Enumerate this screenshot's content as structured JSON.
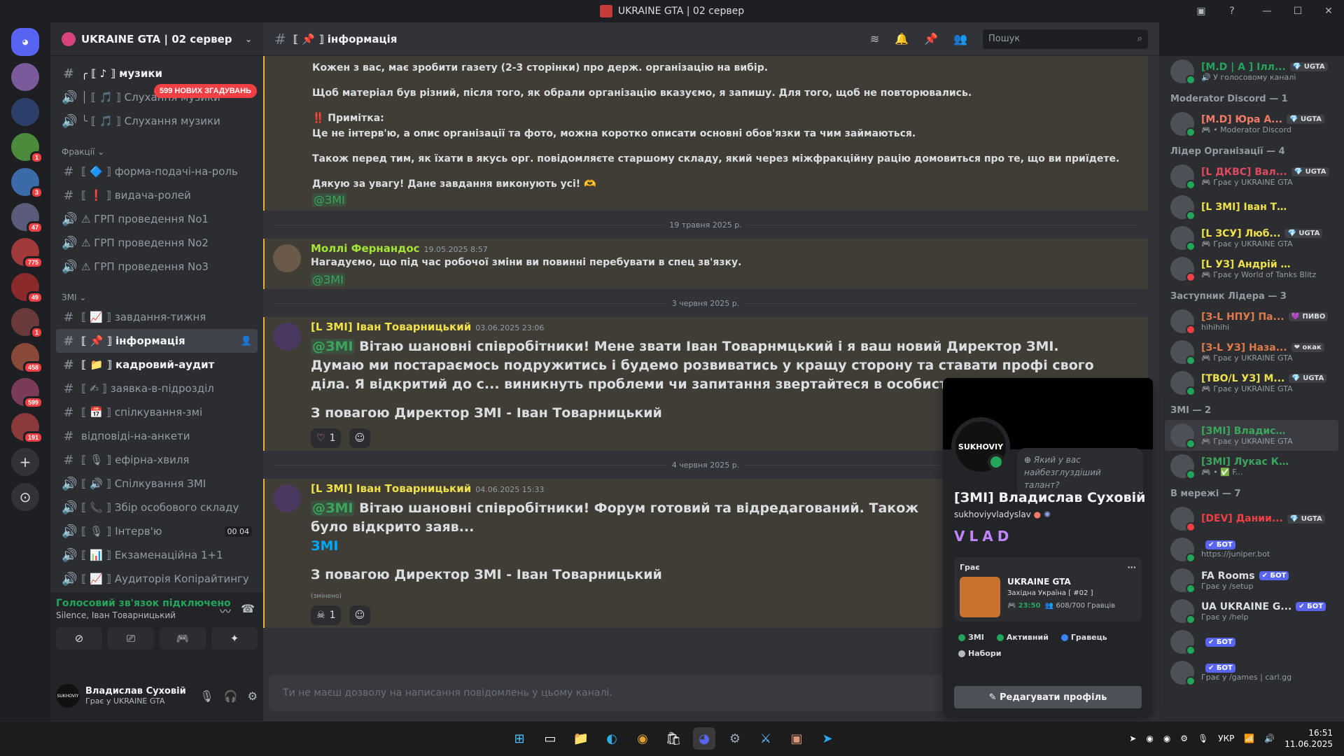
{
  "window": {
    "title": "UKRAINE GTA | 02 сервер"
  },
  "rail": {
    "servers": [
      {
        "name": "discord-home",
        "badge": ""
      },
      {
        "name": "server-1",
        "badge": ""
      },
      {
        "name": "server-2",
        "badge": ""
      },
      {
        "name": "server-3",
        "badge": "1"
      },
      {
        "name": "server-4",
        "badge": "3"
      },
      {
        "name": "server-5",
        "badge": "47"
      },
      {
        "name": "server-6",
        "badge": "775"
      },
      {
        "name": "server-7",
        "badge": "49"
      },
      {
        "name": "server-8",
        "badge": "1"
      },
      {
        "name": "server-9",
        "badge": "458"
      },
      {
        "name": "server-10",
        "badge": "599"
      },
      {
        "name": "server-11",
        "badge": "191"
      }
    ],
    "add": "+",
    "explore": "⊙"
  },
  "sidebar": {
    "guild": "UKRAINE GTA | 02 сервер",
    "mention_pill": "599 НОВИХ ЗГАДУВАНЬ",
    "top_items": [
      {
        "icon": "#",
        "label": "╭ ⟦ ♪ ⟧ музики"
      },
      {
        "icon": "🔊",
        "label": "│ ⟦ 🎵 ⟧ Слухання музики"
      },
      {
        "icon": "🔊",
        "label": "╰ ⟦ 🎵 ⟧ Слухання музики"
      }
    ],
    "cat_fractions": "Фракції ⌄",
    "fraction_items": [
      {
        "icon": "#",
        "label": "⟦ 🔷 ⟧ форма-подачі-на-роль"
      },
      {
        "icon": "#",
        "label": "⟦ ❗ ⟧ видача-ролей"
      },
      {
        "icon": "🔊",
        "label": "⚠ ГРП проведення No1"
      },
      {
        "icon": "🔊",
        "label": "⚠ ГРП проведення No2"
      },
      {
        "icon": "🔊",
        "label": "⚠ ГРП проведення No3"
      }
    ],
    "cat_zmi": "ЗМІ ⌄",
    "zmi_items": [
      {
        "icon": "#",
        "label": "⟦ 📈 ⟧ завдання-тижня"
      },
      {
        "icon": "#",
        "label": "⟦ 📌 ⟧ інформація"
      },
      {
        "icon": "#",
        "label": "⟦ 📁 ⟧ кадровий-аудит"
      },
      {
        "icon": "#",
        "label": "⟦ ✍ ⟧ заявка-в-підрозділ"
      },
      {
        "icon": "#",
        "label": "⟦ 📅 ⟧ спілкування-змі"
      },
      {
        "icon": "#",
        "label": "відповіді-на-анкети"
      },
      {
        "icon": "#",
        "label": "⟦ 🎙 ⟧ ефірна-хвиля"
      },
      {
        "icon": "🔊",
        "label": "⟦ 🔊 ⟧ Спілкування ЗМІ"
      },
      {
        "icon": "🔊",
        "label": "⟦ 📞 ⟧ Збір особового складу"
      },
      {
        "icon": "🔊",
        "label": "⟦ 🎙 ⟧ Інтерв'ю"
      },
      {
        "icon": "🔊",
        "label": "⟦ 📊 ⟧ Екзаменаційна 1+1"
      },
      {
        "icon": "🔊",
        "label": "⟦ 📈 ⟧ Аудиторія Копірайтингу"
      }
    ],
    "interview_limit": "00 04",
    "voice": {
      "status": "Голосовий зв'язок підключено",
      "sub": "Silence, Іван Товарницький"
    },
    "user": {
      "name": "Владислав Суховій",
      "status": "Грає у UKRAINE GTA",
      "avatar_text": "SUKHOVIY"
    }
  },
  "chat": {
    "channel": "⟦ 📌 ⟧ інформація",
    "search_placeholder": "Пошук",
    "composer_placeholder": "Ти не маєш дозволу на написання повідомлень у цьому каналі.",
    "first": {
      "l1": "Кожен з вас, має зробити газету (2-3 сторінки) про держ. організацію на вибір.",
      "l2": "Щоб матеріал був різний, після того, як обрали організацію вказуємо, я запишу. Для того, щоб не повторювались.",
      "note_title": "‼️ Примітка:",
      "l3": "Це не інтерв'ю, а опис організації та фото, можна коротко описати основні обов'язки та чим займаються.",
      "l4": "Також перед тим, як їхати в якусь орг. повідомляєте старшому складу, який через міжфракційну рацію домовиться про те, що ви приїдете.",
      "l5": "Дякую за увагу! Дане завдання виконують усі! 🫶",
      "mention": "@ЗМІ"
    },
    "divider1": "19 травня 2025 р.",
    "molly": {
      "author": "Моллі Фернандос",
      "ts": "19.05.2025 8:57",
      "text": "Нагадуємо, що під час робочої зміни ви повинні перебувати в спец зв'язку.",
      "mention": "@ЗМІ"
    },
    "divider2": "3 червня 2025 р.",
    "ivan1": {
      "author": "[L ЗМІ] Іван Товарницький",
      "ts": "03.06.2025 23:06",
      "mention": "@ЗМІ",
      "text": "Вітаю шановні співробітники! Мене звати Іван Товарнмцький і я ваш новий Директор ЗМІ. Думаю ми постараємось подружитись і будемо розвиватись у кращу сторону та ставати профі свого діла. Я відкритий до с... виникнуть проблеми чи запитання звертайтеся в особисті повідомлення.",
      "sign": "З повагою Директор ЗМІ - Іван Товарницький",
      "react_count": "1"
    },
    "divider3": "4 червня 2025 р.",
    "ivan2": {
      "author": "[L ЗМІ] Іван Товарницький",
      "ts": "04.06.2025 15:33",
      "mention": "@ЗМІ",
      "text": "Вітаю шановні співробітники! Форум готовий та відредагований. Також було відкрито заяв...",
      "text2": "ЗМІ",
      "sign": "З повагою Директор ЗМІ - Іван Товарницький",
      "edited": "(змінено)",
      "react_count": "1"
    }
  },
  "members": {
    "top": {
      "name": "[M.D | A ] Ілл...",
      "tag": "💎 UGTA",
      "status": "🔊 У голосовому каналі",
      "color": "#23a55a"
    },
    "groups": [
      {
        "title": "Moderator Discord — 1",
        "items": [
          {
            "name": "[M.D] Юра А...",
            "tag": "💎 UGTA",
            "status": "🎮 • Moderator Discord",
            "color": "#f47b67",
            "st": "#23a55a"
          }
        ]
      },
      {
        "title": "Лідер Організації — 4",
        "items": [
          {
            "name": "[L ДКВС] Вал...",
            "tag": "💎 UGTA",
            "status": "🎮 Грає у UKRAINE GTA",
            "color": "#e04a5f",
            "st": "#23a55a"
          },
          {
            "name": "[L ЗМІ] Іван Товарни...",
            "tag": "",
            "status": "",
            "color": "#f0e14a",
            "st": "#23a55a"
          },
          {
            "name": "[L ЗСУ] Люб...",
            "tag": "💎 UGTA",
            "status": "🎮 Грає у UKRAINE GTA",
            "color": "#f0e14a",
            "st": "#23a55a"
          },
          {
            "name": "[L УЗ] Андрій Ашваг...",
            "tag": "",
            "status": "🎮 Грає у World of Tanks Blitz",
            "color": "#f0e14a",
            "st": "#f23f43"
          }
        ]
      },
      {
        "title": "Заступник Лідера — 3",
        "items": [
          {
            "name": "[З-L НПУ] Па...",
            "tag": "💜 ПИВО",
            "status": "hihihihi",
            "color": "#e07a4a",
            "st": "#f23f43"
          },
          {
            "name": "[З-L УЗ] Наза...",
            "tag": "❤ окак",
            "status": "🎮 Грає у UKRAINE GTA",
            "color": "#e07a4a",
            "st": "#23a55a"
          },
          {
            "name": "[ТВО/L УЗ] М...",
            "tag": "💎 UGTA",
            "status": "🎮 Грає у UKRAINE GTA",
            "color": "#f0e14a",
            "st": "#23a55a"
          }
        ]
      },
      {
        "title": "ЗМІ — 2",
        "items": [
          {
            "name": "[ЗМІ] Владислав Сух...",
            "tag": "",
            "status": "🎮 Грає у UKRAINE GTA",
            "color": "#3ba55c",
            "st": "#23a55a",
            "sel": true
          },
          {
            "name": "[ЗМІ] Лукас Кейт",
            "tag": "",
            "status": "🎮 • ✅ F...",
            "color": "#3ba55c",
            "st": "#23a55a"
          }
        ]
      },
      {
        "title": "В мережі — 7",
        "items": [
          {
            "name": "[DEV] Дании...",
            "tag": "💎 UGTA",
            "status": "",
            "color": "#f23f43",
            "st": "#f23f43"
          },
          {
            "name": "",
            "tag": "✔ БОТ",
            "status": "https://juniper.bot",
            "color": "#dbdee1",
            "st": "#23a55a",
            "bot": true
          },
          {
            "name": "FA Rooms",
            "tag": "✔ БОТ",
            "status": "Грає у /setup",
            "color": "#dbdee1",
            "st": "#23a55a",
            "bot": true
          },
          {
            "name": "UA UKRAINE G...",
            "tag": "✔ БОТ",
            "status": "Грає у /help",
            "color": "#dbdee1",
            "st": "#23a55a",
            "bot": true
          },
          {
            "name": "",
            "tag": "✔ БОТ",
            "status": "",
            "color": "#dbdee1",
            "st": "#23a55a",
            "bot": true
          },
          {
            "name": "",
            "tag": "✔ БОТ",
            "status": "Грає у /games | carl.gg",
            "color": "#dbdee1",
            "st": "#23a55a",
            "bot": true
          }
        ]
      }
    ]
  },
  "popout": {
    "avatar_text": "SUKHOVIY",
    "note": "Який у вас найбезглуздіший талант?",
    "name": "[ЗМІ] Владислав Суховій",
    "username": "sukhoviyvladyslav",
    "vlad": "VLAD",
    "game_header": "Грає",
    "game_more": "···",
    "game_title": "UKRAINE GTA",
    "game_sub": "Західна Україна [ #02 ]",
    "game_time": "23:50",
    "game_players": "608/700 Гравців",
    "roles": [
      {
        "label": "ЗМІ",
        "color": "#23a55a"
      },
      {
        "label": "Активний",
        "color": "#23a55a"
      },
      {
        "label": "Гравець",
        "color": "#3b82f6"
      },
      {
        "label": "Набори",
        "color": "#b5bac1"
      }
    ],
    "edit": "✎ Редагувати профіль"
  },
  "taskbar": {
    "lang": "УКР",
    "time": "16:51",
    "date": "11.06.2025"
  }
}
